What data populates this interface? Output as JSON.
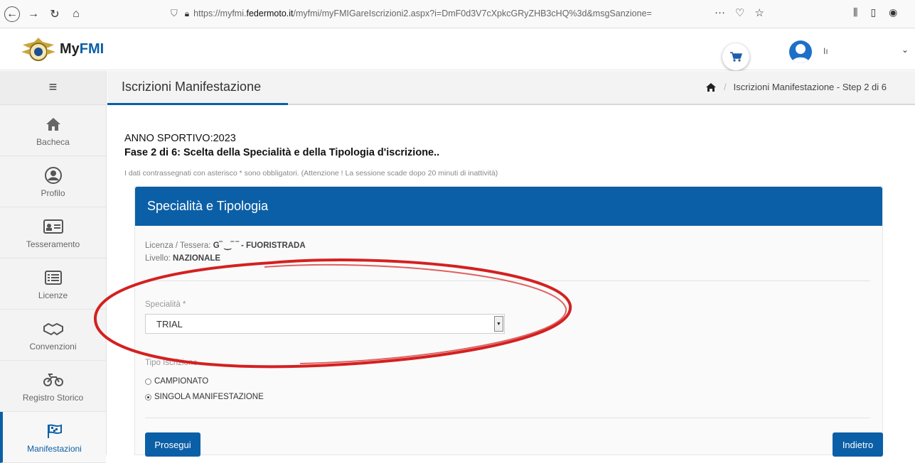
{
  "browser": {
    "url_prefix": "https://myfmi.",
    "url_domain": "federmoto.it",
    "url_suffix": "/myfmi/myFMIGareIscrizioni2.aspx?i=DmF0d3V7cXpkcGRyZHB3cHQ%3d&msgSanzione=",
    "overflow_label": "···"
  },
  "header": {
    "logo_prefix": "My",
    "logo_brand": "FMI",
    "user_name": "Iı"
  },
  "sidebar": {
    "items": [
      {
        "label": "Bacheca"
      },
      {
        "label": "Profilo"
      },
      {
        "label": "Tesseramento"
      },
      {
        "label": "Licenze"
      },
      {
        "label": "Convenzioni"
      },
      {
        "label": "Registro Storico"
      },
      {
        "label": "Manifestazioni"
      }
    ]
  },
  "page": {
    "title": "Iscrizioni Manifestazione",
    "breadcrumb": "Iscrizioni Manifestazione - Step 2 di 6",
    "year": "ANNO SPORTIVO:2023",
    "phase": "Fase 2 di 6: Scelta della Specialità e della Tipologia d'iscrizione..",
    "note": "I dati contrassegnati con asterisco * sono obbligatori. (Attenzione ! La sessione scade dopo 20 minuti di inattività)"
  },
  "panel": {
    "title": "Specialità e Tipologia",
    "license_label": "Licenza / Tessera: ",
    "license_value": "G‾ ‿‾ ‾ - FUORISTRADA",
    "level_label": "Livello: ",
    "level_value": "NAZIONALE",
    "specialty_label": "Specialità *",
    "specialty_value": "TRIAL",
    "type_label": "Tipo Iscrizione",
    "options": [
      {
        "label": "CAMPIONATO",
        "selected": false
      },
      {
        "label": "SINGOLA MANIFESTAZIONE",
        "selected": true
      }
    ],
    "continue_label": "Prosegui",
    "back_label": "Indietro"
  },
  "colors": {
    "accent": "#0b5fa6",
    "annotation": "#d42020"
  }
}
